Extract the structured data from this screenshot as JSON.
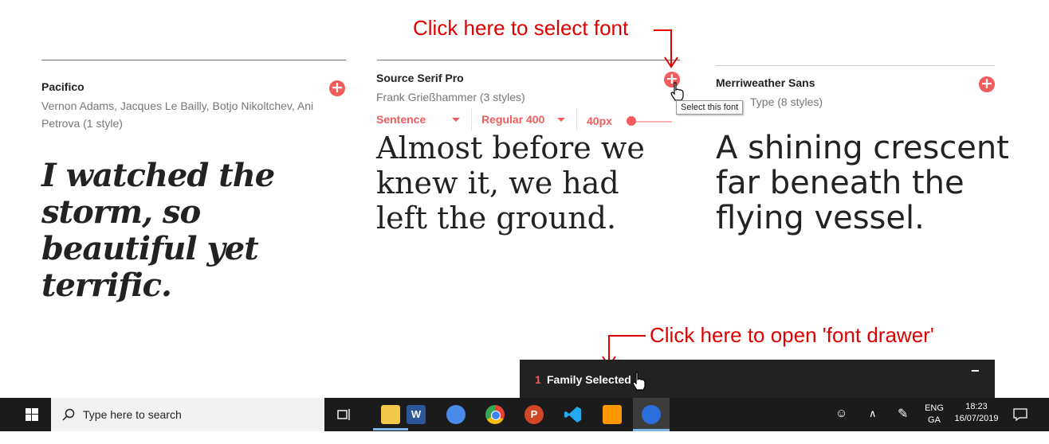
{
  "fonts": [
    {
      "name": "Pacifico",
      "designer": "Vernon Adams, Jacques Le Bailly, Botjo Nikoltchev, Ani Petrova (1 style)",
      "sample": "I watched the storm, so beautiful yet terrific."
    },
    {
      "name": "Source Serif Pro",
      "designer": "Frank Grießhammer (3 styles)",
      "sample": "Almost before we knew it, we had left the ground."
    },
    {
      "name": "Merriweather Sans",
      "designer": "Sorkin Type (8 styles)",
      "designer_visible": "Type (8 styles)",
      "sample": "A shining crescent far beneath the flying vessel."
    }
  ],
  "controls": {
    "sentence": "Sentence",
    "weight": "Regular 400",
    "size": "40px",
    "slider_fraction": 0.1
  },
  "tooltip": "Select this font",
  "annotations": {
    "select_font": "Click here to select font",
    "open_drawer": "Click here to open 'font drawer'"
  },
  "drawer": {
    "count": "1",
    "label": "Family Selected",
    "minimize": "−"
  },
  "taskbar": {
    "search_placeholder": "Type here to search",
    "lang_top": "ENG",
    "lang_bottom": "GA",
    "time": "18:23",
    "date": "16/07/2019"
  },
  "colors": {
    "accent": "#f25c5c",
    "annotation": "#e00000",
    "taskbar": "#1b1b1b"
  }
}
